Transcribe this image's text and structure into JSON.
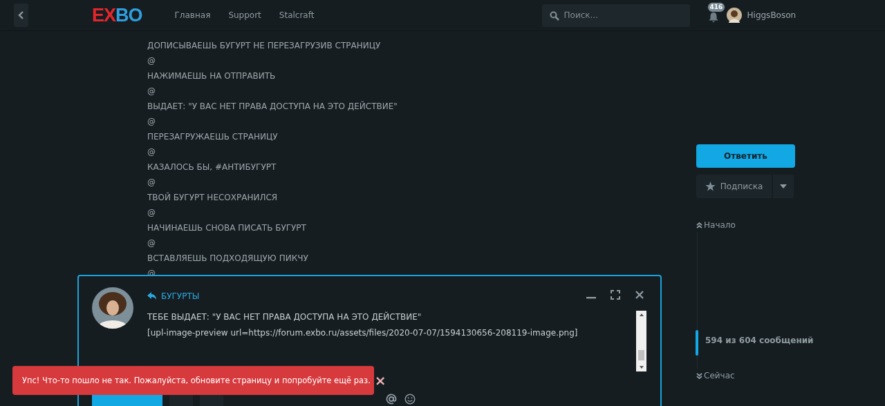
{
  "header": {
    "logo": [
      {
        "text": "EX",
        "color": "#e4262c"
      },
      {
        "text": "BO",
        "color": "#2f9fe0"
      }
    ],
    "nav": [
      {
        "label": "Главная"
      },
      {
        "label": "Support"
      },
      {
        "label": "Stalcraft"
      }
    ],
    "search": {
      "placeholder": "Поиск..."
    },
    "notifications": {
      "count": "416"
    },
    "user": {
      "name": "HiggsBoson"
    }
  },
  "post": {
    "lines": [
      "ДОПИСЫВАЕШЬ БУГУРТ НЕ ПЕРЕЗАГРУЗИВ СТРАНИЦУ",
      "@",
      "НАЖИМАЕШЬ НА ОТПРАВИТЬ",
      "@",
      "ВЫДАЕТ: \"У ВАС НЕТ ПРАВА ДОСТУПА НА ЭТО ДЕЙСТВИЕ\"",
      "@",
      "ПЕРЕЗАГРУЖАЕШЬ СТРАНИЦУ",
      "@",
      "КАЗАЛОСЬ БЫ, #АНТИБУГУРТ",
      "@",
      "ТВОЙ БУГУРТ НЕСОХРАНИЛСЯ",
      "@",
      "НАЧИНАЕШЬ СНОВА ПИСАТЬ БУГУРТ",
      "@",
      "ВСТАВЛЯЕШЬ ПОДХОДЯЩУЮ ПИКЧУ",
      "@"
    ]
  },
  "sidebar": {
    "reply_button": "Ответить",
    "subscribe_button": "Подписка",
    "scrubber": {
      "start": "Начало",
      "position": "594 из 604 сообщений",
      "now": "Сейчас"
    }
  },
  "composer": {
    "reply_to": "БУГУРТЫ",
    "text": "ТЕБЕ ВЫДАЕТ: \"У ВАС НЕТ ПРАВА ДОСТУПА НА ЭТО ДЕЙСТВИЕ\"\n[upl-image-preview url=https://forum.exbo.ru/assets/files/2020-07-07/1594130656-208119-image.png]"
  },
  "alert": {
    "message": "Упс! Что-то пошло не так. Пожалуйста, обновите страницу и попробуйте ещё раз.",
    "close": "×"
  }
}
